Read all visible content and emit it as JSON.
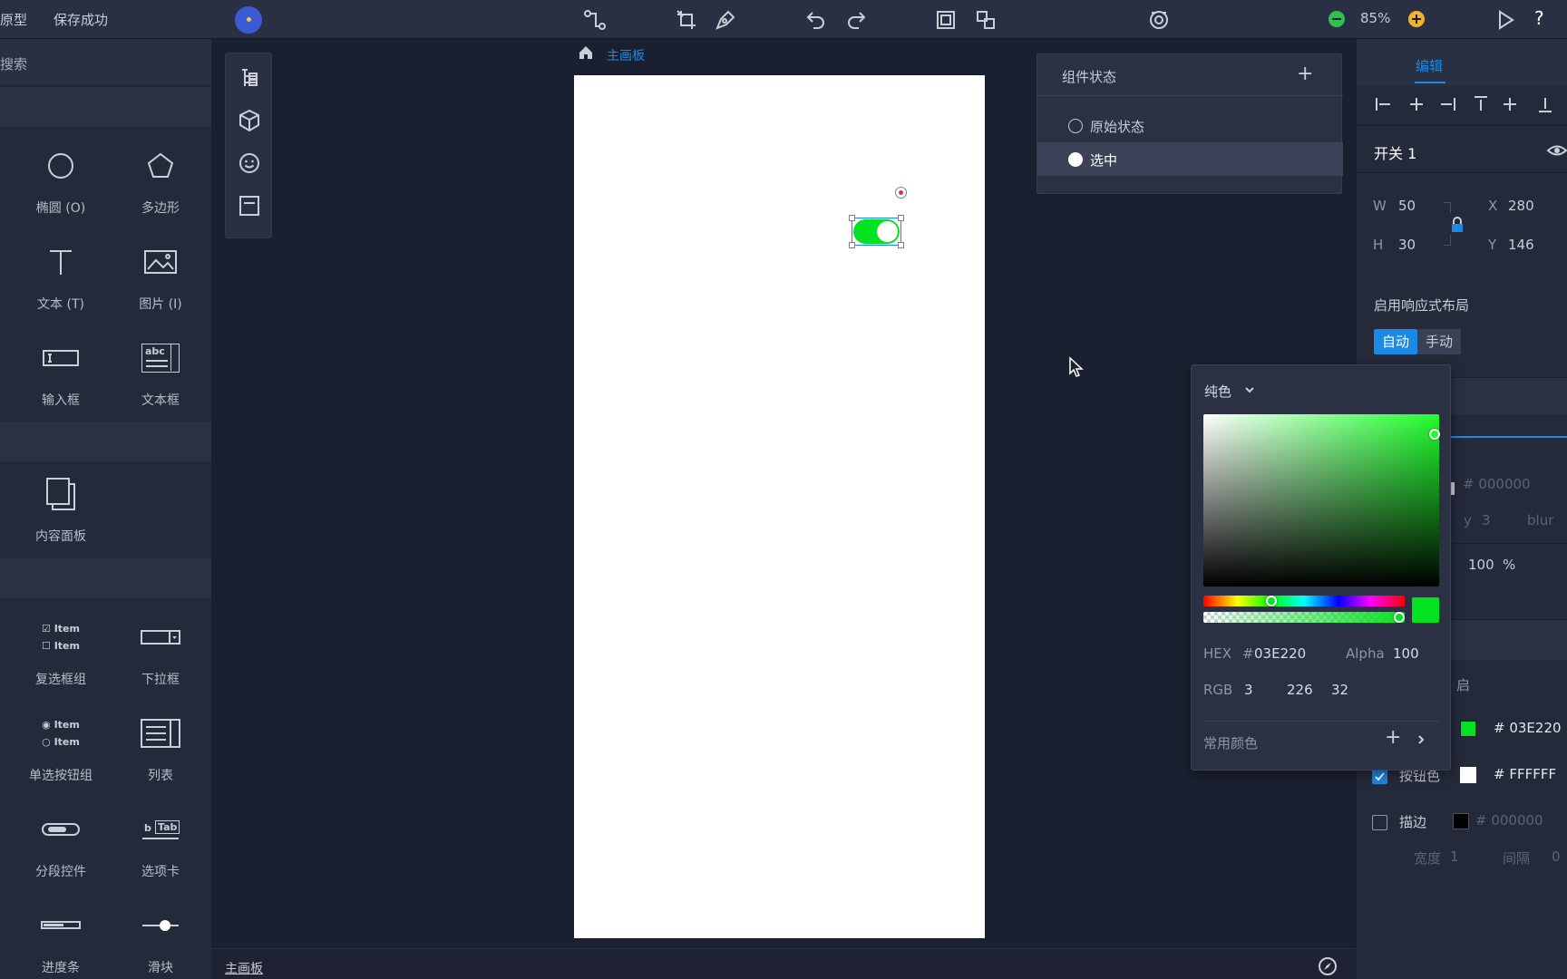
{
  "topbar": {
    "app_title": "原型",
    "save_status": "保存成功",
    "zoom": "85%"
  },
  "search": {
    "placeholder": "搜索"
  },
  "widgets": {
    "ellipse": "椭圆 (O)",
    "polygon": "多边形",
    "text": "文本 (T)",
    "image": "图片 (I)",
    "input": "输入框",
    "textarea": "文本框",
    "content_panel": "内容面板",
    "checkbox_group": "复选框组",
    "dropdown": "下拉框",
    "radio_group": "单选按钮组",
    "list": "列表",
    "segmented": "分段控件",
    "tabs": "选项卡",
    "progress": "进度条",
    "slider": "滑块",
    "glyph_item": "Item",
    "glyph_abc": "abc",
    "glyph_tab": "Tab",
    "glyph_b": "b"
  },
  "canvas": {
    "breadcrumb": "主画板",
    "bottom_label": "主画板"
  },
  "states_panel": {
    "title": "组件状态",
    "states": [
      "原始状态",
      "选中"
    ],
    "selected_index": 1
  },
  "right_panel": {
    "tab": "编辑",
    "component_name": "开关 1",
    "w_label": "W",
    "w": "50",
    "h_label": "H",
    "h": "30",
    "x_label": "X",
    "x": "280",
    "y_label": "Y",
    "y": "146",
    "responsive_label": "启用响应式布局",
    "auto": "自动",
    "manual": "手动",
    "shadow_hex": "# 000000",
    "shadow_y_label": "y",
    "shadow_y": "3",
    "shadow_blur_label": "blur",
    "opacity": "100",
    "opacity_unit": "%",
    "color_hex": "# 03E220",
    "button_color_label": "按钮色",
    "button_color_hex": "# FFFFFF",
    "stroke_label": "描边",
    "stroke_hex": "# 000000",
    "width_label": "宽度",
    "width": "1",
    "gap_label": "间隔",
    "gap": "0",
    "partial_label": "启"
  },
  "color_picker": {
    "mode": "纯色",
    "hex_label": "HEX",
    "hex_hash": "#",
    "hex": "03E220",
    "alpha_label": "Alpha",
    "alpha": "100",
    "rgb_label": "RGB",
    "r": "3",
    "g": "226",
    "b": "32",
    "common_colors": "常用颜色",
    "hue_fraction": 0.33,
    "alpha_fraction": 1.0
  },
  "colors": {
    "accent": "#1a8ae6",
    "toggle_on": "#03E220",
    "button": "#FFFFFF"
  }
}
